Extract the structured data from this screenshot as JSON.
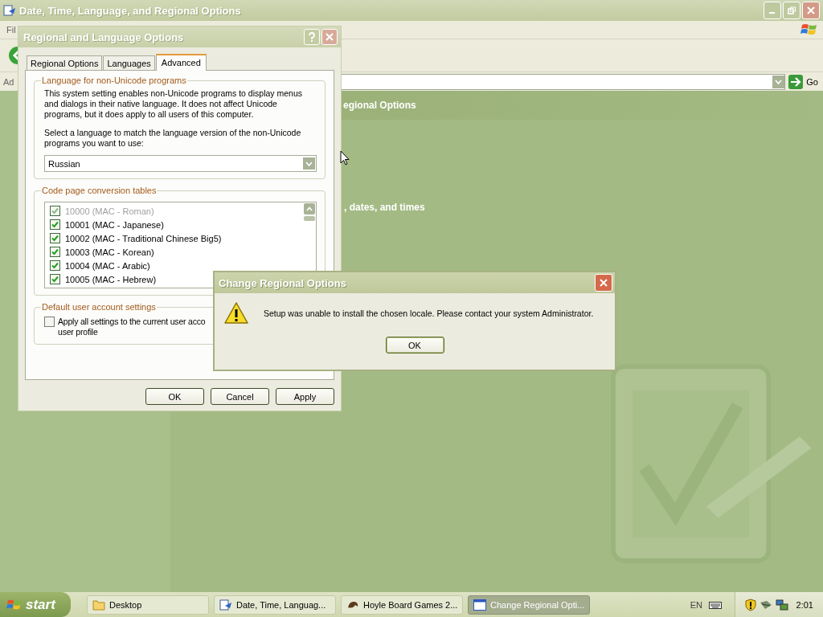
{
  "main_window": {
    "title": "Date, Time, Language, and Regional Options",
    "menu": [
      "Fil"
    ],
    "address_label": "Ad",
    "go_label": "Go",
    "header": "egional Options",
    "task": ", dates, and times"
  },
  "dialog": {
    "title": "Regional and Language Options",
    "tabs": [
      {
        "label": "Regional Options",
        "selected": false
      },
      {
        "label": "Languages",
        "selected": false
      },
      {
        "label": "Advanced",
        "selected": true
      }
    ],
    "language_group": {
      "title": "Language for non-Unicode programs",
      "description": "This system setting enables non-Unicode programs to display menus and dialogs in their native language. It does not affect Unicode programs, but it does apply to all users of this computer.",
      "prompt": "Select a language to match the language version of the non-Unicode programs you want to use:",
      "language": "Russian"
    },
    "code_page_group": {
      "title": "Code page conversion tables",
      "items": [
        {
          "label": "10000 (MAC - Roman)",
          "checked": true,
          "disabled": true
        },
        {
          "label": "10001 (MAC - Japanese)",
          "checked": true,
          "disabled": false
        },
        {
          "label": "10002 (MAC - Traditional Chinese Big5)",
          "checked": true,
          "disabled": false
        },
        {
          "label": "10003 (MAC - Korean)",
          "checked": true,
          "disabled": false
        },
        {
          "label": "10004 (MAC - Arabic)",
          "checked": true,
          "disabled": false
        },
        {
          "label": "10005 (MAC - Hebrew)",
          "checked": true,
          "disabled": false
        }
      ]
    },
    "default_group": {
      "title": "Default user account settings",
      "checked": false,
      "label_lines": [
        "Apply all settings to the current user acco",
        "user profile"
      ]
    },
    "buttons": [
      "OK",
      "Cancel",
      "Apply"
    ]
  },
  "message": {
    "title": "Change Regional Options",
    "text": "Setup was unable to install the chosen locale.  Please contact your system Administrator.",
    "button": "OK"
  },
  "taskbar": {
    "start": "start",
    "items": [
      {
        "label": "Desktop",
        "kind": "folder",
        "selected": false
      },
      {
        "label": "Date, Time, Languag...",
        "kind": "control-panel",
        "selected": false
      },
      {
        "label": "Hoyle Board Games 2...",
        "kind": "game",
        "selected": false
      },
      {
        "label": "Change Regional Opti...",
        "kind": "window",
        "selected": true
      }
    ],
    "language": "EN",
    "clock": "2:01"
  }
}
